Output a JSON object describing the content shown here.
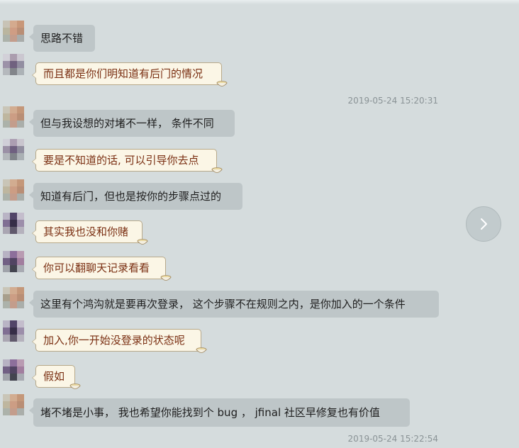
{
  "messages": [
    {
      "id": 1,
      "text": "思路不错",
      "style": "grey"
    },
    {
      "id": 2,
      "text": "而且都是你们明知道有后门的情况",
      "style": "cream"
    },
    {
      "id": 3,
      "text": "但与我设想的对堵不一样， 条件不同",
      "style": "grey"
    },
    {
      "id": 4,
      "text": "要是不知道的话, 可以引导你去点",
      "style": "cream"
    },
    {
      "id": 5,
      "text": "知道有后门，但也是按你的步骤点过的",
      "style": "grey"
    },
    {
      "id": 6,
      "text": "其实我也没和你赌",
      "style": "cream"
    },
    {
      "id": 7,
      "text": "你可以翻聊天记录看看",
      "style": "cream"
    },
    {
      "id": 8,
      "text": "这里有个鸿沟就是要再次登录， 这个步骤不在规则之内，是你加入的一个条件",
      "style": "grey"
    },
    {
      "id": 9,
      "text": "加入,你一开始没登录的状态呢",
      "style": "cream"
    },
    {
      "id": 10,
      "text": "假如",
      "style": "cream"
    },
    {
      "id": 11,
      "text": "堵不堵是小事， 我也希望你能找到个 bug ， jfinal 社区早修复也有价值",
      "style": "grey"
    }
  ],
  "timestamps": [
    "2019-05-24 15:20:31",
    "2019-05-24 15:22:54"
  ],
  "icons": {
    "next": "chevron-right-icon",
    "emoji": "tea-bowl-icon"
  },
  "colors": {
    "background": "#d5dcdd",
    "grey_bubble": "#bec6c8",
    "cream_bubble": "#fbf6e6",
    "cream_text": "#7a2f12"
  }
}
